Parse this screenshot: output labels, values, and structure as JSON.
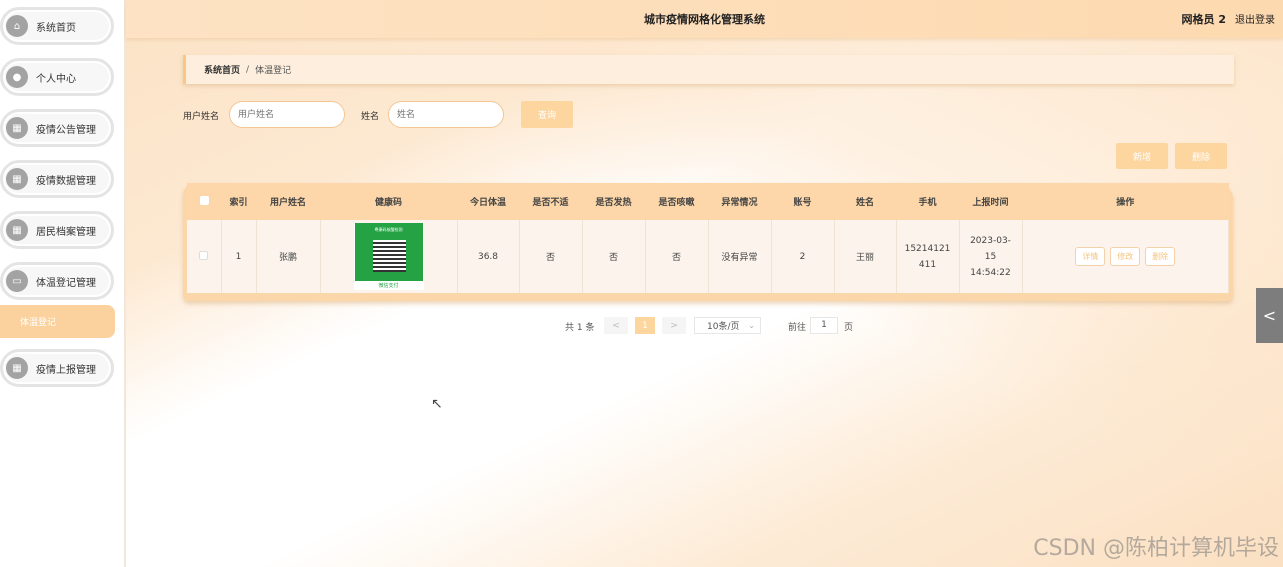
{
  "header": {
    "title": "城市疫情网格化管理系统",
    "user": "网格员 2",
    "logout": "退出登录"
  },
  "sidebar": {
    "items": [
      {
        "label": "系统首页",
        "icon": "home-icon"
      },
      {
        "label": "个人中心",
        "icon": "person-icon"
      },
      {
        "label": "疫情公告管理",
        "icon": "grid-icon"
      },
      {
        "label": "疫情数据管理",
        "icon": "grid-icon"
      },
      {
        "label": "居民档案管理",
        "icon": "grid-icon"
      },
      {
        "label": "体温登记管理",
        "icon": "monitor-icon"
      },
      {
        "label": "疫情上报管理",
        "icon": "grid-icon"
      }
    ],
    "active_sub": "体温登记"
  },
  "breadcrumb": {
    "home": "系统首页",
    "sep": "/",
    "current": "体温登记"
  },
  "search": {
    "username_label": "用户姓名",
    "username_placeholder": "用户姓名",
    "name_label": "姓名",
    "name_placeholder": "姓名",
    "query_button": "查询"
  },
  "actions": {
    "add": "新增",
    "delete": "删除"
  },
  "table": {
    "headers": [
      "索引",
      "用户姓名",
      "健康码",
      "今日体温",
      "是否不适",
      "是否发热",
      "是否咳嗽",
      "异常情况",
      "账号",
      "姓名",
      "手机",
      "上报时间",
      "操作"
    ],
    "rows": [
      {
        "index": "1",
        "username": "张鹏",
        "health_code_title": "粤康码核酸检测",
        "health_code_footer": "微信支付",
        "temperature": "36.8",
        "discomfort": "否",
        "fever": "否",
        "cough": "否",
        "abnormal": "没有异常",
        "account": "2",
        "name": "王丽",
        "phone": "15214121411",
        "report_time": "2023-03-15 14:54:22",
        "ops": [
          "详情",
          "修改",
          "删除"
        ]
      }
    ]
  },
  "pagination": {
    "total": "共 1 条",
    "prev": "<",
    "current_page": "1",
    "next": ">",
    "page_size": "10条/页",
    "goto_label": "前往",
    "goto_value": "1",
    "goto_suffix": "页"
  },
  "watermark": "CSDN @陈柏计算机毕设",
  "side_tab": "<",
  "colors": {
    "accent": "#fdd59f",
    "header": "#fde3c4",
    "health_green": "#25a244"
  }
}
